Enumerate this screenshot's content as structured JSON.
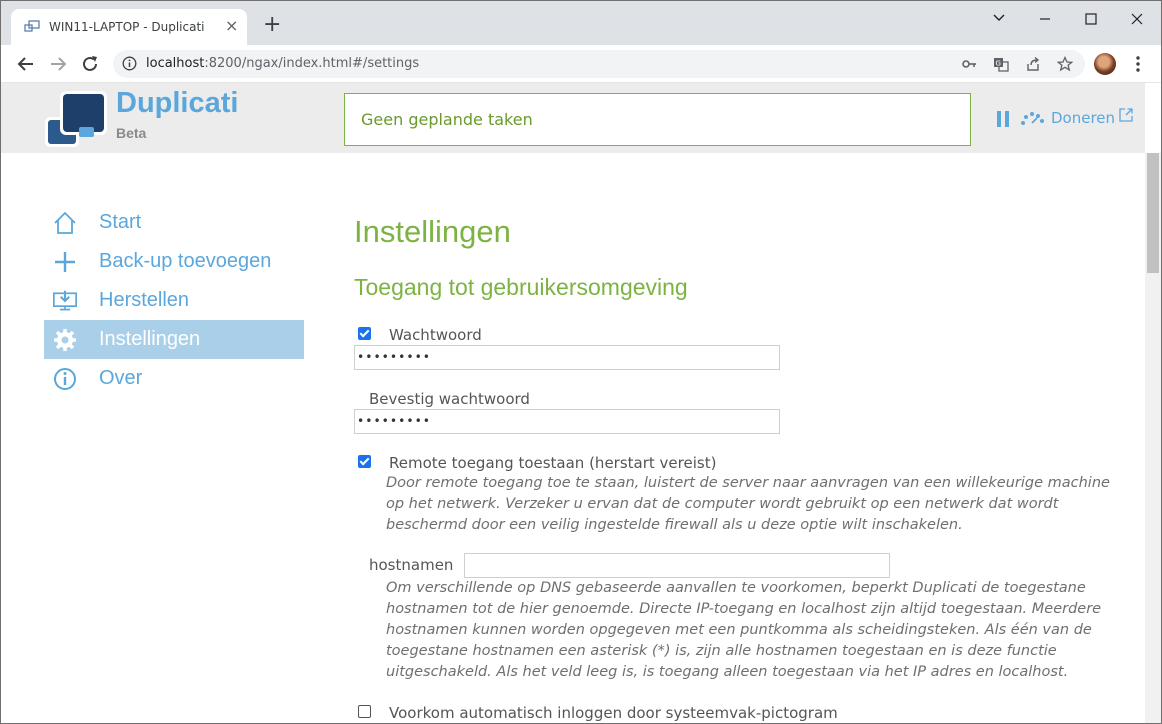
{
  "browser": {
    "tab_title": "WIN11-LAPTOP - Duplicati",
    "tab_close": "×",
    "new_tab": "+",
    "url_host": "localhost",
    "url_rest": ":8200/ngax/index.html#/settings",
    "window_controls": {
      "minimize": "⌄",
      "restore": "—",
      "maximize": "☐",
      "close": "✕"
    }
  },
  "header": {
    "brand": "Duplicati",
    "subtitle": "Beta",
    "status": "Geen geplande taken",
    "donate": "Doneren"
  },
  "sidebar": {
    "items": [
      {
        "label": "Start",
        "icon": "home-icon",
        "active": false
      },
      {
        "label": "Back-up toevoegen",
        "icon": "plus-icon",
        "active": false
      },
      {
        "label": "Herstellen",
        "icon": "restore-icon",
        "active": false
      },
      {
        "label": "Instellingen",
        "icon": "gear-icon",
        "active": true
      },
      {
        "label": "Over",
        "icon": "info-icon",
        "active": false
      }
    ]
  },
  "main": {
    "title": "Instellingen",
    "section_title": "Toegang tot gebruikersomgeving",
    "password": {
      "label": "Wachtwoord",
      "checked": true,
      "value": "•••••••••"
    },
    "confirm_password": {
      "label": "Bevestig wachtwoord",
      "value": "•••••••••"
    },
    "remote": {
      "label": "Remote toegang toestaan (herstart vereist)",
      "checked": true,
      "help": "Door remote toegang toe te staan, luistert de server naar aanvragen van een willekeurige machine op het netwerk. Verzeker u ervan dat de computer wordt gebruikt op een netwerk dat wordt beschermd door een veilig ingestelde firewall als u deze optie wilt inschakelen."
    },
    "hostnames": {
      "label": "hostnamen",
      "value": "",
      "help": "Om verschillende op DNS gebaseerde aanvallen te voorkomen, beperkt Duplicati de toegestane hostnamen tot de hier genoemde. Directe IP-toegang en localhost zijn altijd toegestaan. Meerdere hostnamen kunnen worden opgegeven met een puntkomma als scheidingsteken. Als één van de toegestane hostnamen een asterisk (*) is, zijn alle hostnamen toegestaan en is deze functie uitgeschakeld. Als het veld leeg is, is toegang alleen toegestaan via het IP adres en localhost."
    },
    "autologin": {
      "label": "Voorkom automatisch inloggen door systeemvak-pictogram",
      "checked": false
    }
  },
  "colors": {
    "accent_blue": "#5ba7dc",
    "accent_green": "#7cb342",
    "active_nav_bg": "#a9cfe9"
  }
}
